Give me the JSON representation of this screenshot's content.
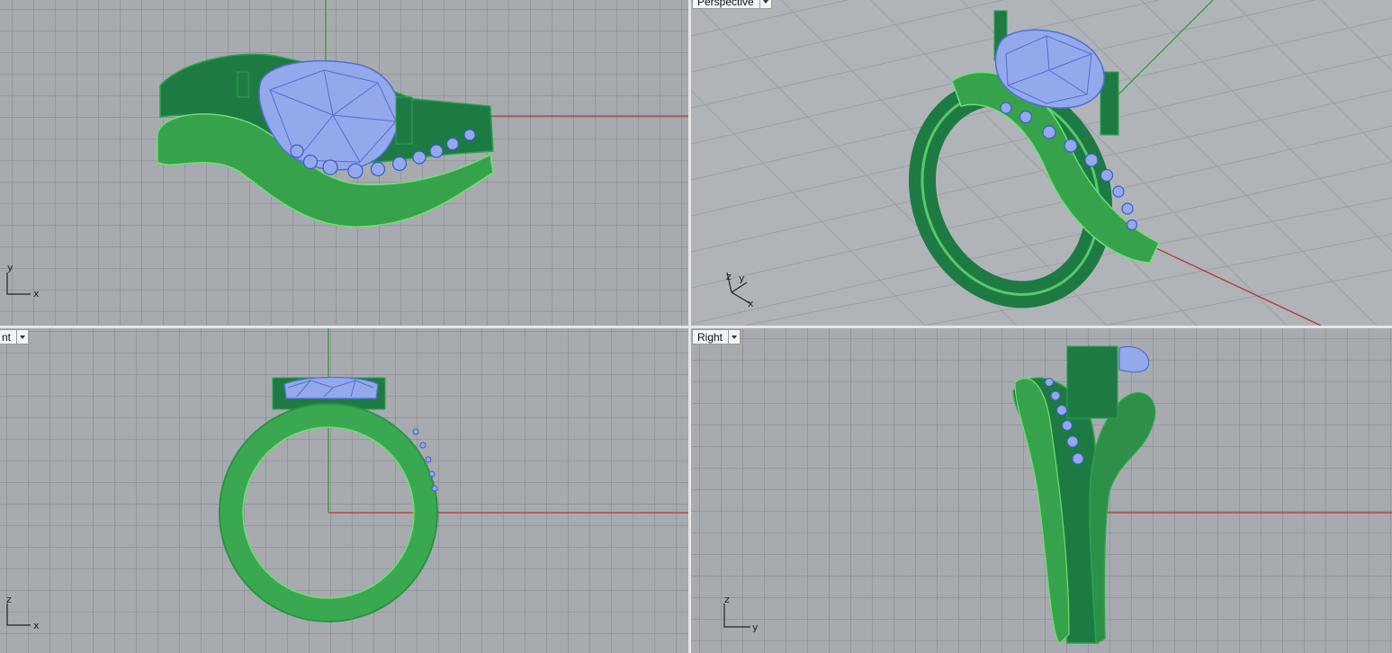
{
  "viewports": {
    "top": {
      "label": "",
      "axes": {
        "h": "x",
        "v": "y"
      }
    },
    "perspective": {
      "label": "Perspective",
      "axes": {
        "x": "x",
        "y": "y",
        "z": "z"
      }
    },
    "front": {
      "label": "nt",
      "axes": {
        "h": "x",
        "v": "z"
      }
    },
    "right": {
      "label": "Right",
      "axes": {
        "h": "y",
        "v": "z"
      }
    }
  },
  "colors": {
    "background": "#a7abaf",
    "grid": "#8c9095",
    "ring_dark": "#1f7a44",
    "ring_light": "#4fbf5d",
    "ring_edge": "#7ee57a",
    "gem_fill": "#93a9ec",
    "gem_wire": "#4f6fd0",
    "x_axis": "#b03a2e",
    "y_axis": "#2f9d2f"
  },
  "icons": {
    "viewport_dropdown": "chevron-down-icon"
  }
}
